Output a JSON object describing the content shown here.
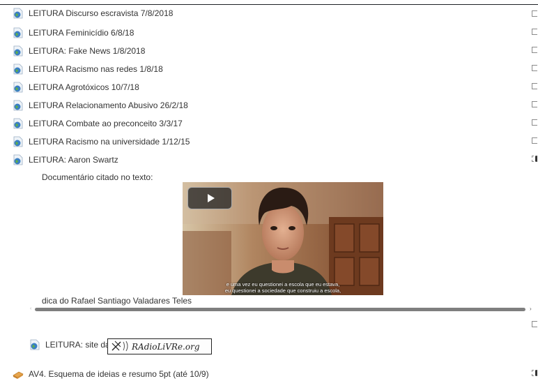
{
  "activities": [
    {
      "label": "LEITURA Discurso escravista 7/8/2018"
    },
    {
      "label": "LEITURA Feminicídio 6/8/18"
    },
    {
      "label": "LEITURA: Fake News 1/8/2018"
    },
    {
      "label": "LEITURA Racismo nas redes 1/8/18"
    },
    {
      "label": "LEITURA Agrotóxicos 10/7/18"
    },
    {
      "label": "LEITURA Relacionamento Abusivo 26/2/18"
    },
    {
      "label": "LEITURA Combate ao preconceito 3/3/17"
    },
    {
      "label": "LEITURA Racismo na universidade 1/12/15"
    },
    {
      "label": "LEITURA: Aaron Swartz"
    }
  ],
  "aaron": {
    "note": "Documentário citado no texto:",
    "caption_line1": "e uma vez eu questionei a escola que eu estava,",
    "caption_line2": "eu questionei a sociedade que construiu a escola,",
    "credit": "dica do Rafael Santiago Valadares Teles"
  },
  "site": {
    "label": "LEITURA: site da",
    "logo_text": "RAdioLiVRe.org"
  },
  "assignment": {
    "label": "AV4. Esquema de ideias e resumo 5pt (até 10/9)"
  },
  "colors": {
    "text": "#333333",
    "accent_globe": "#3a7fc4",
    "check_border": "#8a8a8a"
  }
}
